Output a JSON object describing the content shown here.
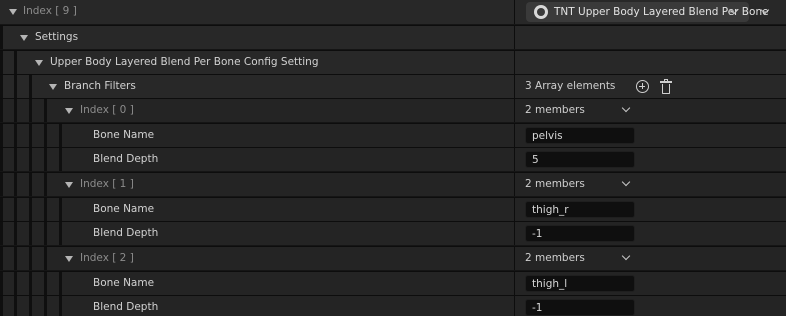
{
  "index9": {
    "label": "Index [ 9 ]",
    "selected_asset": "TNT Upper Body Layered Blend Per Bone"
  },
  "settings": {
    "label": "Settings"
  },
  "config": {
    "label": "Upper Body Layered Blend Per Bone Config Setting"
  },
  "branch_filters": {
    "label": "Branch Filters",
    "count": "3 Array elements"
  },
  "elements": [
    {
      "label": "Index [ 0 ]",
      "summary": "2 members",
      "bone_name_label": "Bone Name",
      "bone_name": "pelvis",
      "blend_depth_label": "Blend Depth",
      "blend_depth": "5"
    },
    {
      "label": "Index [ 1 ]",
      "summary": "2 members",
      "bone_name_label": "Bone Name",
      "bone_name": "thigh_r",
      "blend_depth_label": "Blend Depth",
      "blend_depth": "-1"
    },
    {
      "label": "Index [ 2 ]",
      "summary": "2 members",
      "bone_name_label": "Bone Name",
      "bone_name": "thigh_l",
      "blend_depth_label": "Blend Depth",
      "blend_depth": "-1"
    }
  ],
  "icons": {
    "expanded": "expanded-arrow-icon",
    "dropdown": "chevron-down-icon",
    "asset": "asset-icon",
    "add": "add-element-icon",
    "delete": "delete-all-icon"
  }
}
